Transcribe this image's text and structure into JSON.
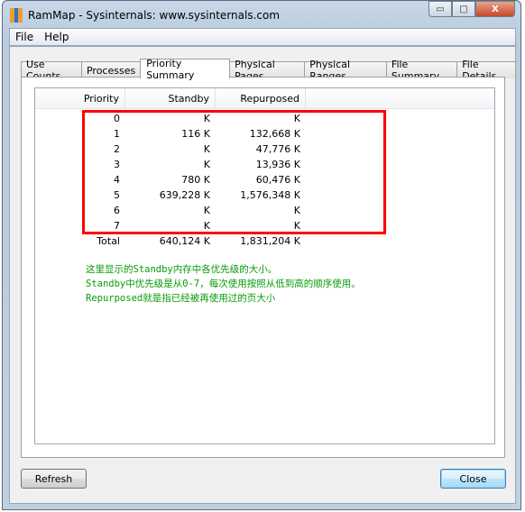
{
  "window": {
    "title": "RamMap - Sysinternals: www.sysinternals.com",
    "controls": {
      "minimize": "▭",
      "maximize": "□",
      "close": "X"
    }
  },
  "menu": [
    "File",
    "Help"
  ],
  "tabs": [
    {
      "label": "Use Counts"
    },
    {
      "label": "Processes"
    },
    {
      "label": "Priority Summary",
      "active": true
    },
    {
      "label": "Physical Pages"
    },
    {
      "label": "Physical Ranges"
    },
    {
      "label": "File Summary"
    },
    {
      "label": "File Details"
    }
  ],
  "table": {
    "columns": [
      "Priority",
      "Standby",
      "Repurposed"
    ],
    "rows": [
      [
        "0",
        "K",
        "K"
      ],
      [
        "1",
        "116 K",
        "132,668 K"
      ],
      [
        "2",
        "K",
        "47,776 K"
      ],
      [
        "3",
        "K",
        "13,936 K"
      ],
      [
        "4",
        "780 K",
        "60,476 K"
      ],
      [
        "5",
        "639,228 K",
        "1,576,348 K"
      ],
      [
        "6",
        "K",
        "K"
      ],
      [
        "7",
        "K",
        "K"
      ],
      [
        "Total",
        "640,124 K",
        "1,831,204 K"
      ]
    ]
  },
  "annotation": {
    "color": "#0a9a0a",
    "highlight_color": "#ff0000",
    "lines": [
      "这里显示的Standby内存中各优先级的大小。",
      "Standby中优先级是从0-7，每次使用按照从低到高的顺序使用。",
      "Repurposed就是指已经被再使用过的页大小"
    ]
  },
  "buttons": {
    "refresh": "Refresh",
    "close": "Close"
  }
}
